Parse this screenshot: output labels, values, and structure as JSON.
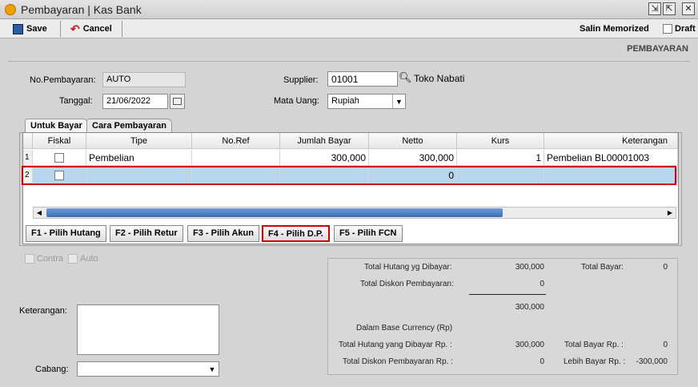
{
  "window": {
    "title": "Pembayaran | Kas Bank"
  },
  "toolbar": {
    "save": "Save",
    "cancel": "Cancel",
    "salin": "Salin Memorized",
    "draft": "Draft"
  },
  "page_label": "PEMBAYARAN",
  "form": {
    "no_label": "No.Pembayaran:",
    "no_value": "AUTO",
    "tanggal_label": "Tanggal:",
    "tanggal_value": "21/06/2022",
    "supplier_label": "Supplier:",
    "supplier_value": "01001",
    "supplier_name": "Toko Nabati",
    "mata_uang_label": "Mata Uang:",
    "mata_uang_value": "Rupiah"
  },
  "tabs": [
    "Untuk Bayar",
    "Cara Pembayaran"
  ],
  "grid": {
    "columns": [
      "Fiskal",
      "Tipe",
      "No.Ref",
      "Jumlah Bayar",
      "Netto",
      "Kurs",
      "Keterangan"
    ],
    "rows": [
      {
        "num": "1",
        "tipe": "Pembelian",
        "noref": "",
        "jumlah": "300,000",
        "netto": "300,000",
        "kurs": "1",
        "ket": "Pembelian BL00001003"
      },
      {
        "num": "2",
        "tipe": "",
        "noref": "",
        "jumlah": "",
        "netto": "0",
        "kurs": "",
        "ket": ""
      }
    ]
  },
  "fkeys": [
    "F1 - Pilih Hutang",
    "F2 - Pilih Retur",
    "F3 - Pilih Akun",
    "F4 - Pilih D.P.",
    "F5 - Pilih FCN"
  ],
  "options": {
    "contra": "Contra",
    "auto": "Auto"
  },
  "bottom": {
    "keterangan_label": "Keterangan:",
    "cabang_label": "Cabang:"
  },
  "summary": {
    "total_hutang_label": "Total Hutang yg Dibayar:",
    "total_hutang": "300,000",
    "total_bayar_label": "Total Bayar:",
    "total_bayar": "0",
    "total_diskon_label": "Total Diskon Pembayaran:",
    "total_diskon": "0",
    "subtotal": "300,000",
    "base_label": "Dalam Base Currency (Rp)",
    "hutang_rp_label": "Total Hutang yang Dibayar Rp. :",
    "hutang_rp": "300,000",
    "bayar_rp_label": "Total Bayar Rp. :",
    "bayar_rp": "0",
    "diskon_rp_label": "Total Diskon Pembayaran Rp. :",
    "diskon_rp": "0",
    "lebih_label": "Lebih Bayar Rp. :",
    "lebih": "-300,000"
  },
  "colors": {
    "selected_row": "#b8d4f0",
    "highlight": "#d00000"
  }
}
